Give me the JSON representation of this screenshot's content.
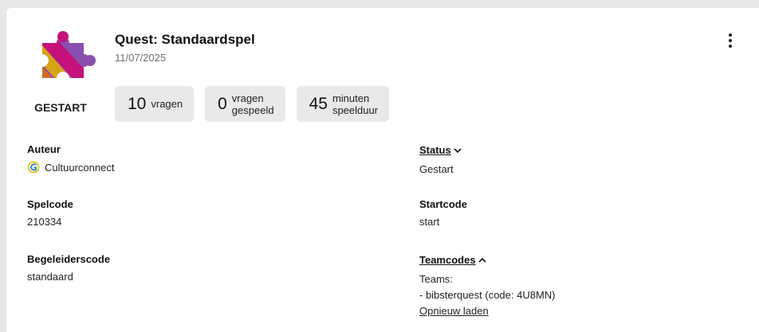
{
  "quest": {
    "title": "Quest: Standaardspel",
    "date": "11/07/2025",
    "status_label": "GESTART"
  },
  "stats": [
    {
      "number": "10",
      "label": "vragen"
    },
    {
      "number": "0",
      "label": "vragen\ngespeeld"
    },
    {
      "number": "45",
      "label": "minuten\nspeelduur"
    }
  ],
  "fields": {
    "auteur": {
      "label": "Auteur",
      "value": "Cultuurconnect"
    },
    "spelcode": {
      "label": "Spelcode",
      "value": "210334"
    },
    "begeleiderscode": {
      "label": "Begeleiderscode",
      "value": "standaard"
    },
    "status": {
      "label": "Status",
      "value": "Gestart"
    },
    "startcode": {
      "label": "Startcode",
      "value": "start"
    },
    "teamcodes": {
      "label": "Teamcodes",
      "teams_heading": "Teams:",
      "team_line": "- bibsterquest (code: 4U8MN)",
      "reload_label": "Opnieuw laden"
    }
  },
  "icons": {
    "menu": "kebab-menu-icon",
    "status_toggle": "chevron-down-icon",
    "teamcodes_toggle": "chevron-up-icon",
    "author": "cultuurconnect-logo-icon"
  },
  "colors": {
    "puzzle_purple": "#8a4fb0",
    "puzzle_magenta": "#c4127a",
    "puzzle_yellow": "#d6a419",
    "puzzle_orange": "#d46a24",
    "background": "#e8e8e8",
    "chip": "#e9e9e9"
  }
}
